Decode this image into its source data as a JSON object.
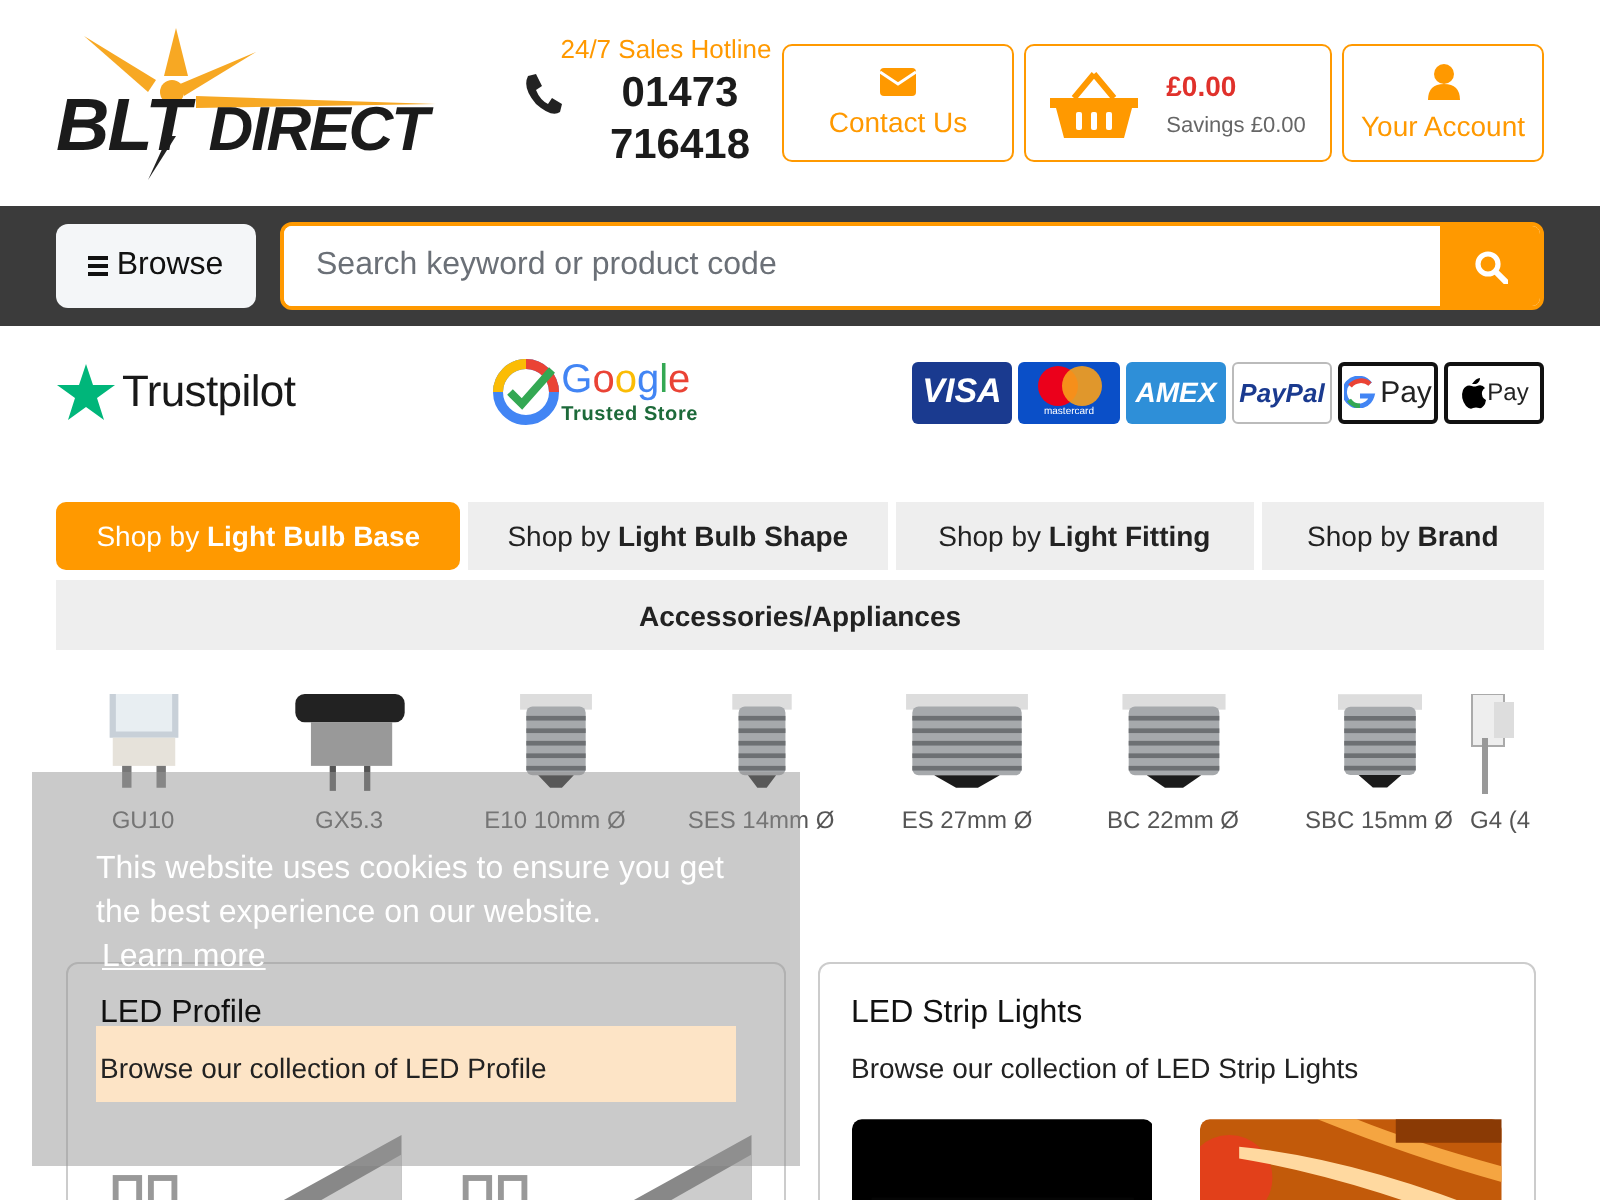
{
  "header": {
    "logo": {
      "first": "BLT",
      "second": "DIRECT"
    },
    "hotline": {
      "label": "24/7 Sales Hotline",
      "number": "01473 716418"
    },
    "actions": [
      {
        "kind": "contact",
        "label": "Contact Us"
      },
      {
        "kind": "basket",
        "total": "£0.00",
        "savings": "Savings £0.00"
      },
      {
        "kind": "account",
        "label": "Your Account"
      }
    ]
  },
  "nav": {
    "browse": "Browse",
    "search": {
      "placeholder": "Search keyword or product code"
    }
  },
  "trust": {
    "trustpilot": "Trustpilot",
    "google": {
      "brand": "Google",
      "caption": "Trusted Store"
    },
    "payments": [
      {
        "kind": "visa",
        "label": "VISA"
      },
      {
        "kind": "mastercard",
        "label": "mastercard"
      },
      {
        "kind": "amex",
        "label": "AMEX"
      },
      {
        "kind": "paypal",
        "label": "PayPal"
      },
      {
        "kind": "gpay",
        "label": "Pay"
      },
      {
        "kind": "applepay",
        "label": "Pay"
      }
    ]
  },
  "tabs": [
    {
      "label": "Shop by **Light Bulb Base**",
      "selected": true
    },
    {
      "label": "Shop by **Light Bulb Shape**",
      "selected": false
    },
    {
      "label": "Shop by **Light Fitting**",
      "selected": false
    },
    {
      "label": "Shop by **Brand**",
      "selected": false
    },
    {
      "label": "**Accessories/Appliances**",
      "selected": false
    }
  ],
  "bases": [
    "GU10",
    "GX5.3",
    "E10 10mm Ø",
    "SES 14mm Ø",
    "ES 27mm Ø",
    "BC 22mm Ø",
    "SBC 15mm Ø",
    "G4 (4"
  ],
  "cards": [
    {
      "title": "LED Profile",
      "text": "Browse our collection of LED Profile"
    },
    {
      "title": "LED Strip Lights",
      "text": "Browse our collection of LED Strip Lights"
    }
  ],
  "cookie": {
    "message": "This website uses cookies to ensure you get the best experience on our website.",
    "link": "Learn more"
  }
}
